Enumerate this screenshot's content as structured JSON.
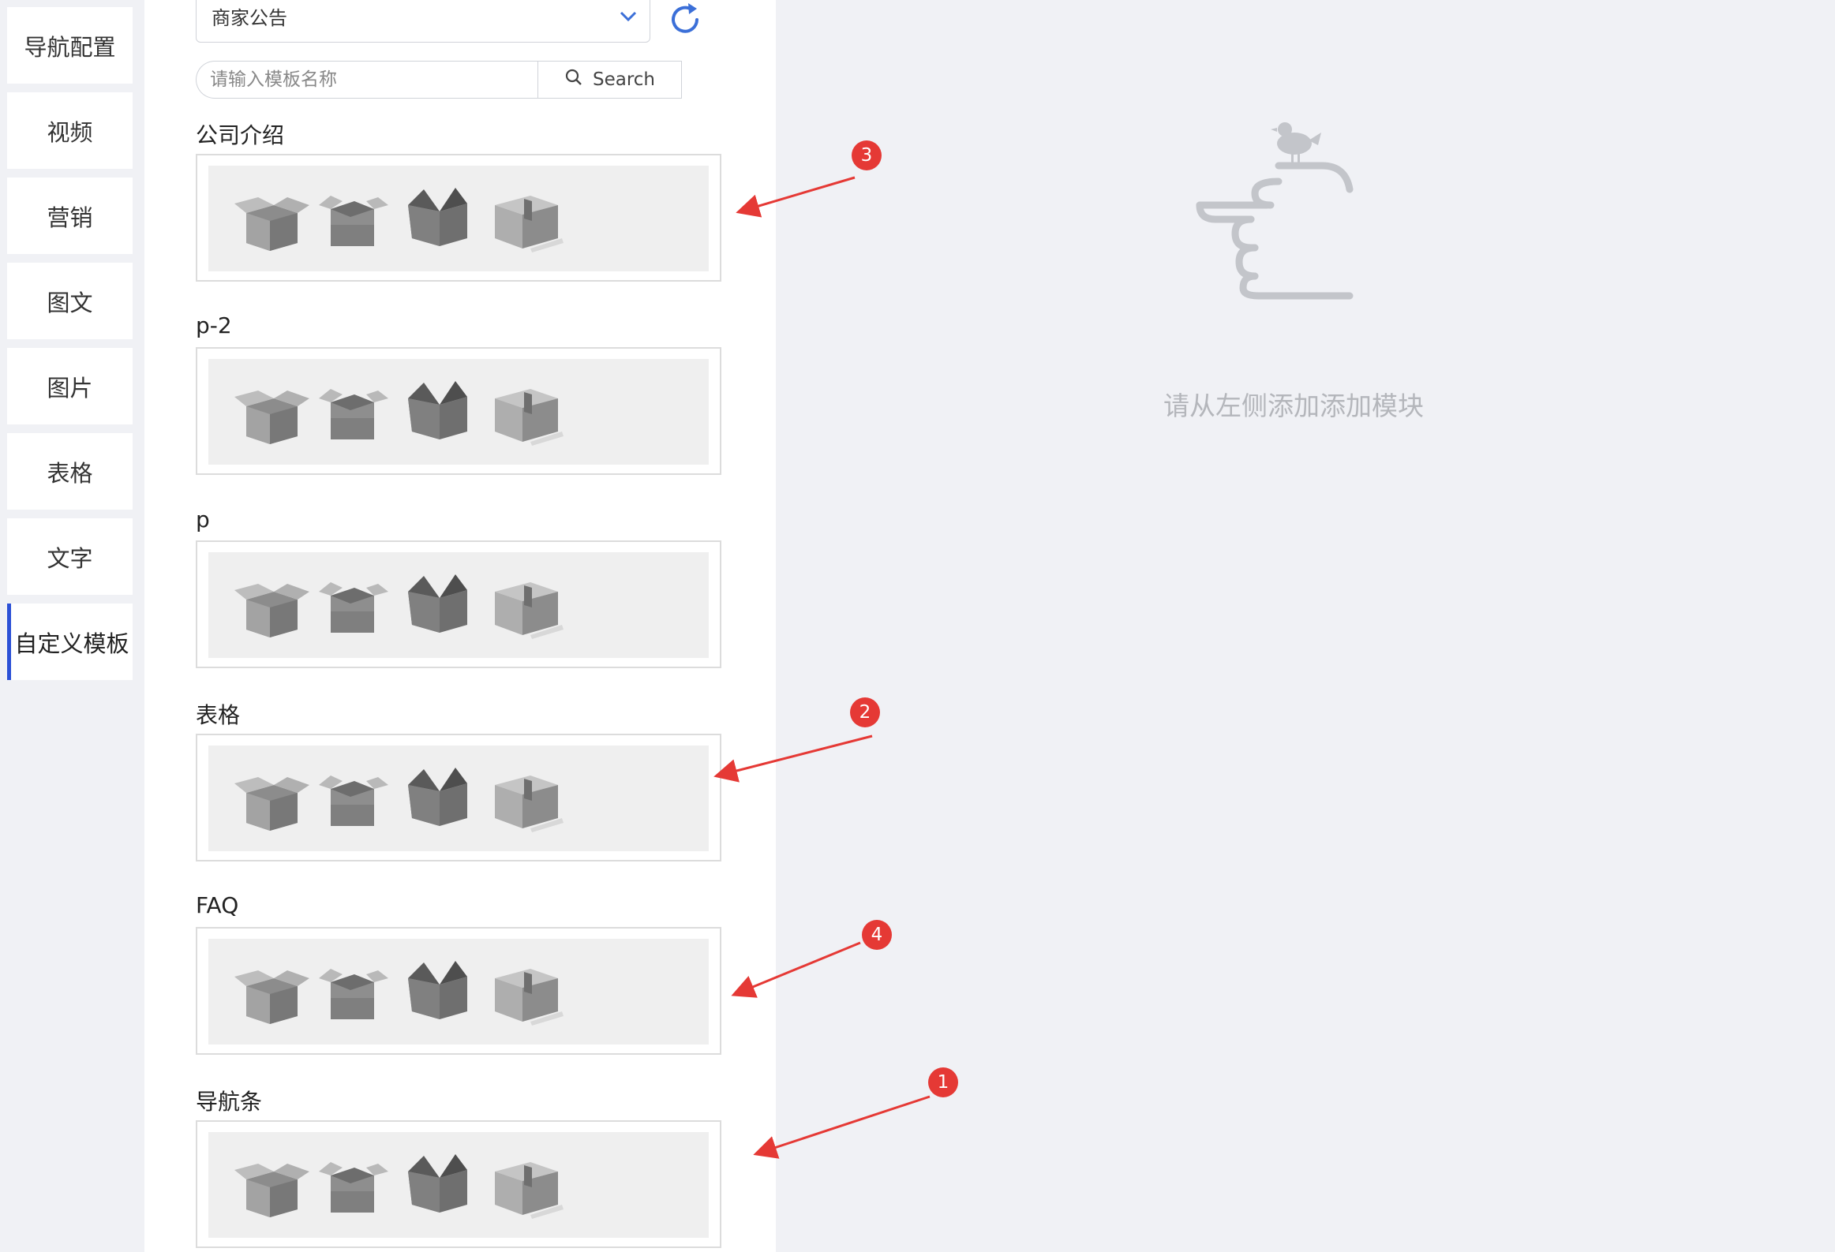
{
  "nav": {
    "items": [
      {
        "label": "导航配置",
        "active": false
      },
      {
        "label": "视频",
        "active": false
      },
      {
        "label": "营销",
        "active": false
      },
      {
        "label": "图文",
        "active": false
      },
      {
        "label": "图片",
        "active": false
      },
      {
        "label": "表格",
        "active": false
      },
      {
        "label": "文字",
        "active": false
      },
      {
        "label": "自定义模板",
        "active": true
      }
    ]
  },
  "panel": {
    "select_value": "商家公告",
    "search_placeholder": "请输入模板名称",
    "search_label": "Search",
    "templates": [
      {
        "title": "公司介绍"
      },
      {
        "title": "p-2"
      },
      {
        "title": "p"
      },
      {
        "title": "表格"
      },
      {
        "title": "FAQ"
      },
      {
        "title": "导航条"
      }
    ]
  },
  "canvas": {
    "empty_text": "请从左侧添加添加模块"
  },
  "annotations": [
    "3",
    "2",
    "4",
    "1"
  ],
  "colors": {
    "accent": "#2b50d6",
    "refresh_icon": "#3b6fd8",
    "badge": "#e53935",
    "arrow": "#e53935"
  }
}
